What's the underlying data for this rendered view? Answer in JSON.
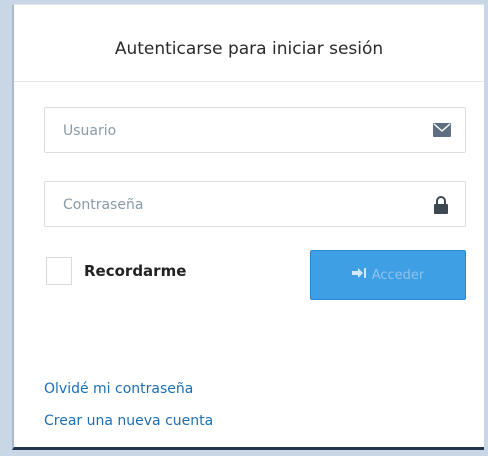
{
  "panel": {
    "title": "Autenticarse para iniciar sesión"
  },
  "username": {
    "placeholder": "Usuario",
    "value": "",
    "icon": "envelope-icon"
  },
  "password": {
    "placeholder": "Contraseña",
    "value": "",
    "icon": "lock-icon"
  },
  "remember": {
    "label": "Recordarme",
    "checked": false
  },
  "login_button": {
    "label": "Acceder",
    "icon": "sign-in-icon",
    "color": "#3f9fe4"
  },
  "links": {
    "forgot": "Olvidé mi contraseña",
    "create": "Crear una nueva cuenta",
    "color": "#1c6fb5"
  }
}
